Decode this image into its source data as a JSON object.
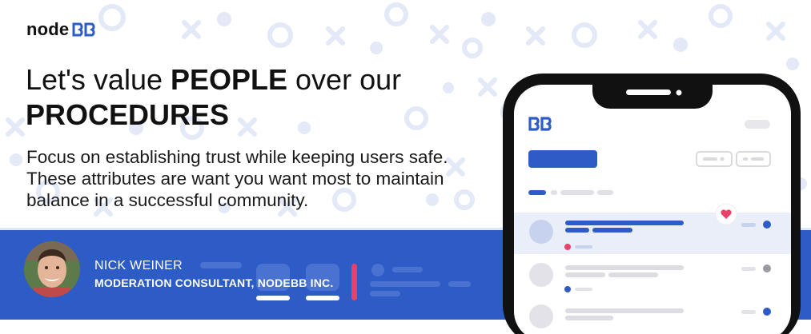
{
  "brand": {
    "logo_text": "node",
    "logo_mark_text": "BB",
    "accent": "#2e5cc7",
    "accent_dark": "#1d4fc4",
    "heart": "#e8416a"
  },
  "headline": {
    "part1": "Let's value ",
    "part2": "PEOPLE",
    "part3": " over our",
    "part4": "PROCEDURES"
  },
  "body": "Focus on establishing trust while keeping users safe. These attributes are want you want most to maintain balance in a successful community.",
  "speaker": {
    "name": "NICK WEINER",
    "title": "MODERATION CONSULTANT, NODEBB INC."
  },
  "phone": {
    "app_logo_text": "BB",
    "icons": [
      "heart-icon"
    ]
  }
}
